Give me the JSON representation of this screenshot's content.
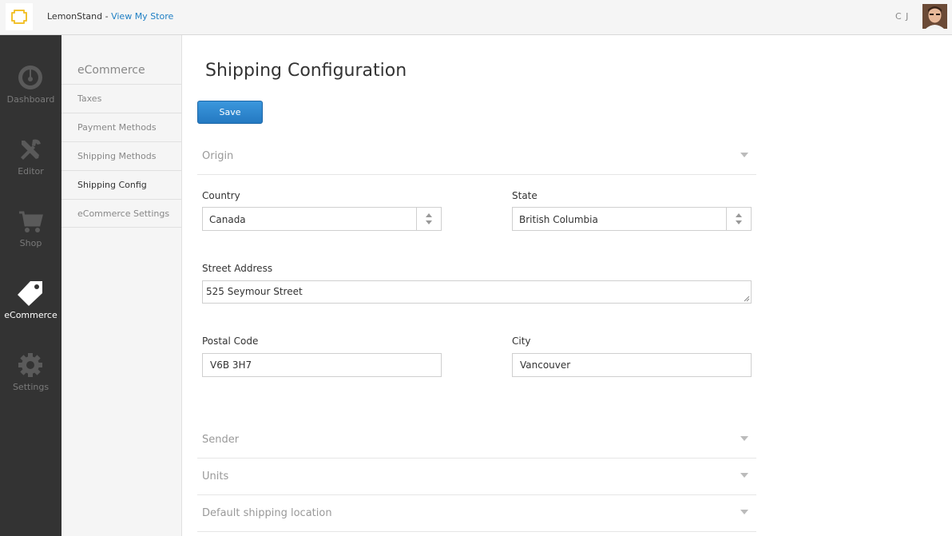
{
  "topbar": {
    "brand": "LemonStand",
    "separator": " - ",
    "store_link": "View My Store",
    "user_initials": "C J"
  },
  "leftnav": [
    {
      "label": "Dashboard",
      "icon": "dashboard-gauge-icon"
    },
    {
      "label": "Editor",
      "icon": "tools-icon"
    },
    {
      "label": "Shop",
      "icon": "cart-icon"
    },
    {
      "label": "eCommerce",
      "icon": "tag-icon",
      "active": true
    },
    {
      "label": "Settings",
      "icon": "gear-icon"
    }
  ],
  "subnav": {
    "title": "eCommerce",
    "items": [
      "Taxes",
      "Payment Methods",
      "Shipping Methods",
      "Shipping Config",
      "eCommerce Settings"
    ],
    "active": "Shipping Config"
  },
  "main": {
    "title": "Shipping Configuration",
    "save_label": "Save",
    "sections": {
      "origin": "Origin",
      "sender": "Sender",
      "units": "Units",
      "default_location": "Default shipping location"
    },
    "fields": {
      "country_label": "Country",
      "country_value": "Canada",
      "state_label": "State",
      "state_value": "British Columbia",
      "street_label": "Street Address",
      "street_value": "525 Seymour Street",
      "postal_label": "Postal Code",
      "postal_value": "V6B 3H7",
      "city_label": "City",
      "city_value": "Vancouver"
    }
  },
  "colors": {
    "nav_bg": "#333333",
    "accent": "#2479c2",
    "link": "#1f7fc4"
  }
}
